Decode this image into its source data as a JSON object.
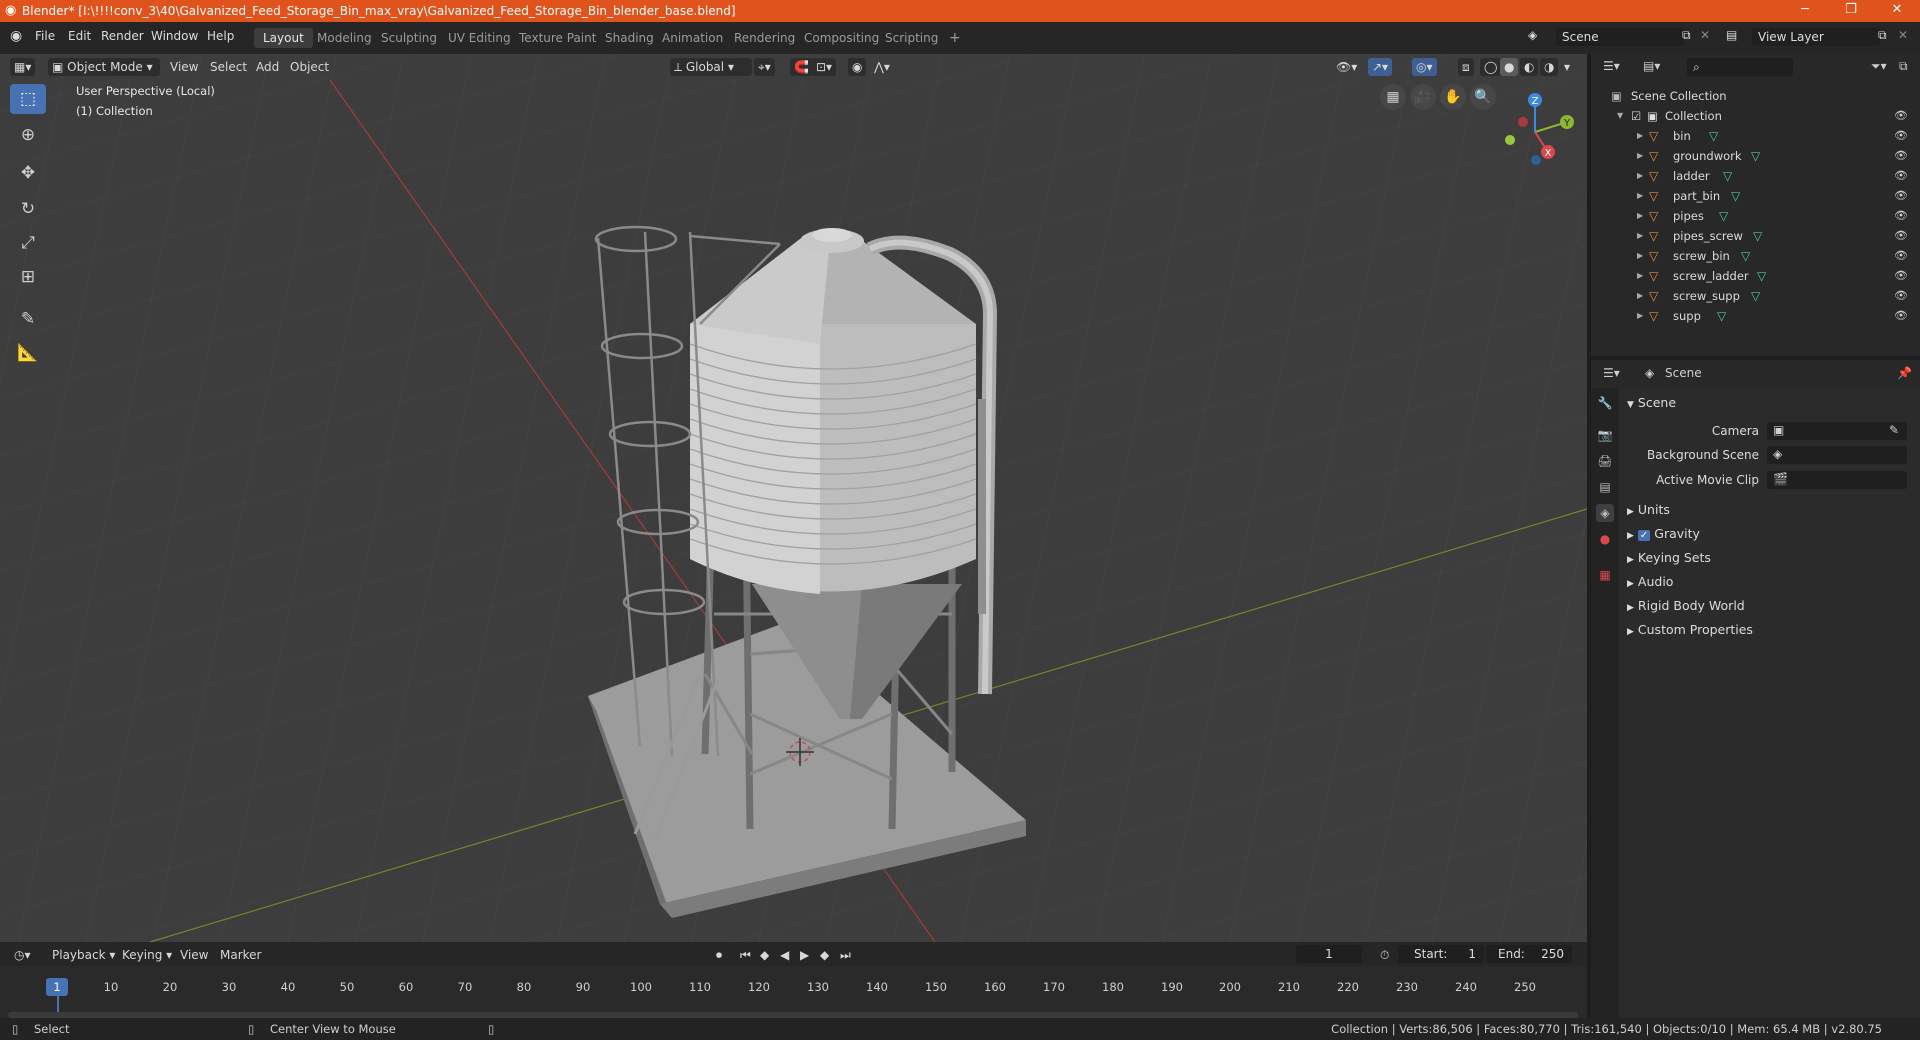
{
  "window": {
    "title": "Blender* [I:\\!!!!conv_3\\40\\Galvanized_Feed_Storage_Bin_max_vray\\Galvanized_Feed_Storage_Bin_blender_base.blend]"
  },
  "menu": [
    "File",
    "Edit",
    "Render",
    "Window",
    "Help"
  ],
  "workspaces": [
    "Layout",
    "Modeling",
    "Sculpting",
    "UV Editing",
    "Texture Paint",
    "Shading",
    "Animation",
    "Rendering",
    "Compositing",
    "Scripting"
  ],
  "active_workspace": "Layout",
  "top_right": {
    "scene": "Scene",
    "view_layer": "View Layer"
  },
  "viewport": {
    "mode": "Object Mode",
    "menus": [
      "View",
      "Select",
      "Add",
      "Object"
    ],
    "transform": "Global",
    "overlay_line1": "User Perspective (Local)",
    "overlay_line2": "(1) Collection",
    "gizmo": {
      "z": "Z",
      "y": "Y",
      "x": "X"
    }
  },
  "outliner": {
    "root": "Scene Collection",
    "collection": "Collection",
    "objects": [
      "bin",
      "groundwork",
      "ladder",
      "part_bin",
      "pipes",
      "pipes_screw",
      "screw_bin",
      "screw_ladder",
      "screw_supp",
      "supp"
    ]
  },
  "properties": {
    "context": "Scene",
    "panel": "Scene",
    "fields": [
      {
        "label": "Camera"
      },
      {
        "label": "Background Scene"
      },
      {
        "label": "Active Movie Clip"
      }
    ],
    "sections": [
      "Units",
      "Gravity",
      "Keying Sets",
      "Audio",
      "Rigid Body World",
      "Custom Properties"
    ],
    "gravity_checked": true
  },
  "timeline": {
    "menus": [
      "Playback",
      "Keying",
      "View",
      "Marker"
    ],
    "current_frame": "1",
    "start_label": "Start:",
    "start": "1",
    "end_label": "End:",
    "end": "250",
    "ticks": [
      "1",
      "10",
      "20",
      "30",
      "40",
      "50",
      "60",
      "70",
      "80",
      "90",
      "100",
      "110",
      "120",
      "130",
      "140",
      "150",
      "160",
      "170",
      "180",
      "190",
      "200",
      "210",
      "220",
      "230",
      "240",
      "250"
    ]
  },
  "status": {
    "left": "Select",
    "middle": "Center View to Mouse",
    "right": "Collection | Verts:86,506 | Faces:80,770 | Tris:161,540 | Objects:0/10 | Mem: 65.4 MB | v2.80.75"
  },
  "colors": {
    "titlebar": "#e0531c",
    "accent": "#4772b3",
    "mesh_icon": "#e3903a",
    "vgroup_icon": "#49c9a2",
    "axis_x": "#d9484f",
    "axis_y": "#8bb82f",
    "axis_z": "#3d88e0"
  }
}
